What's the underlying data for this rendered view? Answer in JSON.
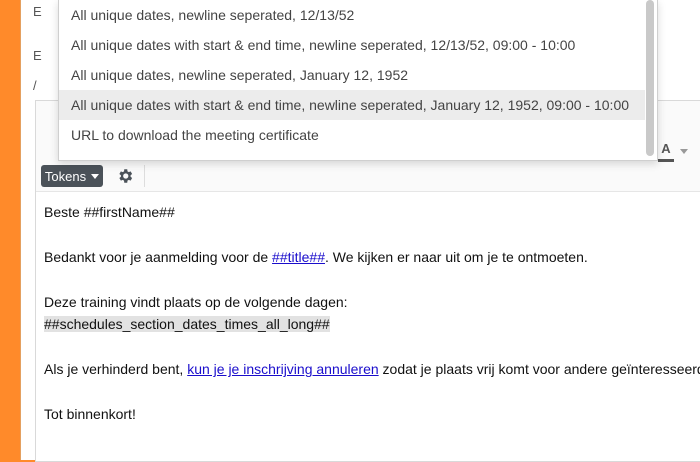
{
  "background_fragments": [
    "E",
    "E",
    "/"
  ],
  "dropdown": {
    "items": [
      "All unique dates, newline seperated, 12/13/52",
      "All unique dates with start & end time, newline seperated, 12/13/52, 09:00 - 10:00",
      "All unique dates, newline seperated, January 12, 1952",
      "All unique dates with start & end time, newline seperated, January 12, 1952, 09:00 - 10:00",
      "URL to download the meeting certificate"
    ],
    "active_index": 3
  },
  "toolbar": {
    "tokens_label": "Tokens",
    "font_color_label": "A",
    "gear_icon": "gear-icon"
  },
  "editor": {
    "greeting": "Beste ##firstName##",
    "thanks_before": "Bedankt voor je aanmelding voor de ",
    "thanks_link": "##title##",
    "thanks_after": ". We kijken er naar uit om je te ontmoeten.",
    "training_line": "Deze training vindt plaats op de volgende dagen:",
    "schedule_token": "##schedules_section_dates_times_all_long##",
    "cancel_before": "Als je verhinderd bent, ",
    "cancel_link": "kun je je inschrijving annuleren",
    "cancel_after": " zodat je plaats vrij komt voor andere geïnteresseerden.",
    "closing": "Tot binnenkort!"
  },
  "colors": {
    "accent_orange": "#ff8a2a",
    "link_blue": "#1a0dcc",
    "tokens_button_bg": "#4b5259"
  }
}
